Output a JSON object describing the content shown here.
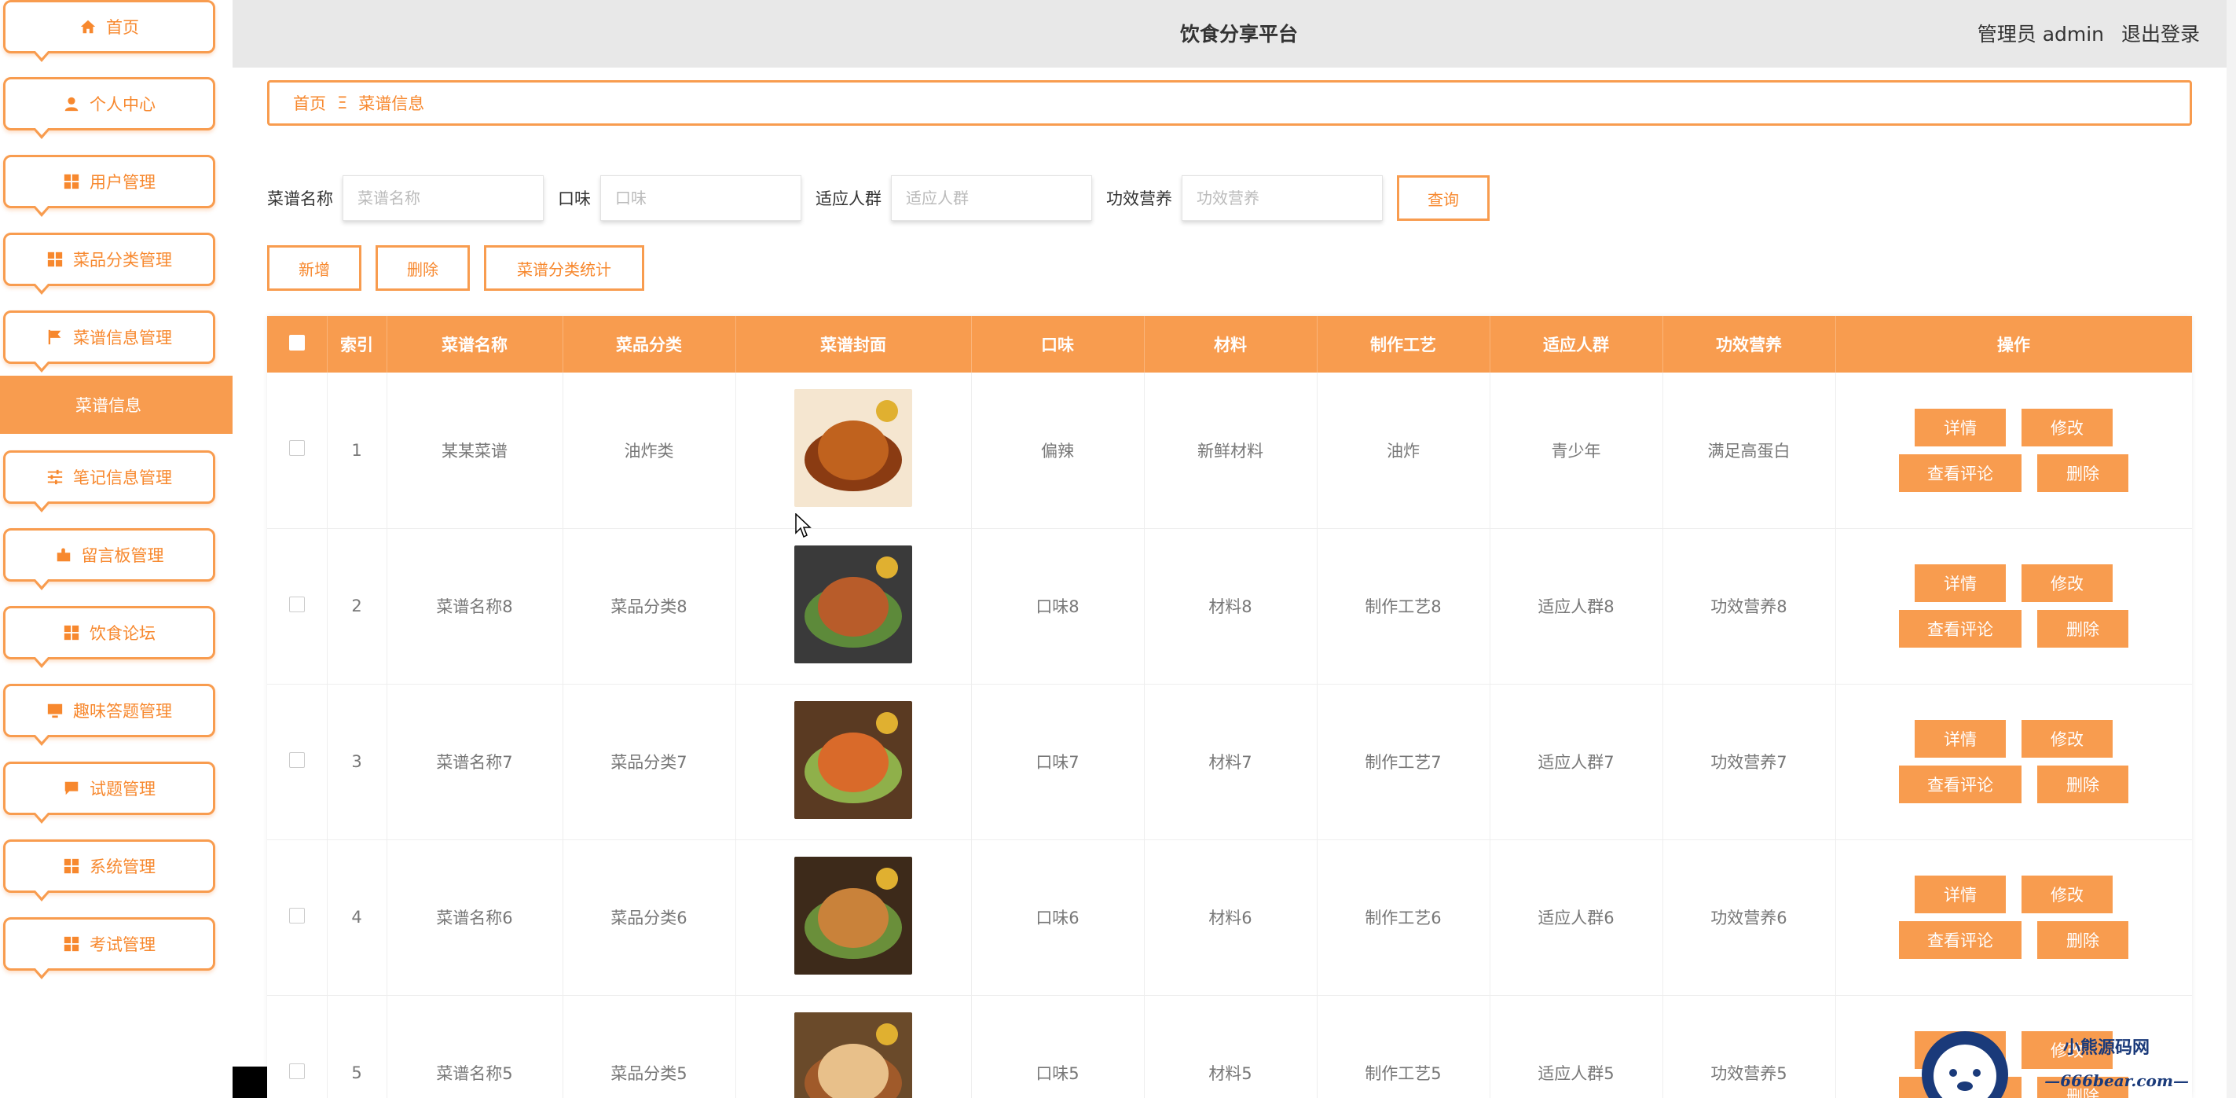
{
  "header": {
    "title": "饮食分享平台",
    "user": "管理员 admin",
    "logout": "退出登录"
  },
  "sidebar": {
    "items": [
      {
        "label": "首页",
        "icon": "home-icon"
      },
      {
        "label": "个人中心",
        "icon": "user-icon"
      },
      {
        "label": "用户管理",
        "icon": "grid-icon"
      },
      {
        "label": "菜品分类管理",
        "icon": "grid-icon"
      },
      {
        "label": "菜谱信息管理",
        "icon": "flag-icon"
      },
      {
        "label": "笔记信息管理",
        "icon": "sliders-icon"
      },
      {
        "label": "留言板管理",
        "icon": "puzzle-icon"
      },
      {
        "label": "饮食论坛",
        "icon": "grid-icon"
      },
      {
        "label": "趣味答题管理",
        "icon": "monitor-icon"
      },
      {
        "label": "试题管理",
        "icon": "chat-icon"
      },
      {
        "label": "系统管理",
        "icon": "grid-icon"
      },
      {
        "label": "考试管理",
        "icon": "grid-icon"
      }
    ],
    "active_sub": "菜谱信息"
  },
  "breadcrumb": {
    "home": "首页",
    "separator": "Ξ",
    "current": "菜谱信息"
  },
  "search": {
    "name_label": "菜谱名称",
    "name_placeholder": "菜谱名称",
    "taste_label": "口味",
    "taste_placeholder": "口味",
    "crowd_label": "适应人群",
    "crowd_placeholder": "适应人群",
    "nutrition_label": "功效营养",
    "nutrition_placeholder": "功效营养",
    "query_label": "查询"
  },
  "actions": {
    "add": "新增",
    "delete": "删除",
    "stats": "菜谱分类统计"
  },
  "table": {
    "columns": [
      "索引",
      "菜谱名称",
      "菜品分类",
      "菜谱封面",
      "口味",
      "材料",
      "制作工艺",
      "适应人群",
      "功效营养",
      "操作"
    ],
    "ops": {
      "detail": "详情",
      "edit": "修改",
      "comments": "查看评论",
      "remove": "删除"
    },
    "rows": [
      {
        "index": "1",
        "name": "某某菜谱",
        "category": "油炸类",
        "taste": "偏辣",
        "material": "新鲜材料",
        "craft": "油炸",
        "crowd": "青少年",
        "nutrition": "满足高蛋白"
      },
      {
        "index": "2",
        "name": "菜谱名称8",
        "category": "菜品分类8",
        "taste": "口味8",
        "material": "材料8",
        "craft": "制作工艺8",
        "crowd": "适应人群8",
        "nutrition": "功效营养8"
      },
      {
        "index": "3",
        "name": "菜谱名称7",
        "category": "菜品分类7",
        "taste": "口味7",
        "material": "材料7",
        "craft": "制作工艺7",
        "crowd": "适应人群7",
        "nutrition": "功效营养7"
      },
      {
        "index": "4",
        "name": "菜谱名称6",
        "category": "菜品分类6",
        "taste": "口味6",
        "material": "材料6",
        "craft": "制作工艺6",
        "crowd": "适应人群6",
        "nutrition": "功效营养6"
      },
      {
        "index": "5",
        "name": "菜谱名称5",
        "category": "菜品分类5",
        "taste": "口味5",
        "material": "材料5",
        "craft": "制作工艺5",
        "crowd": "适应人群5",
        "nutrition": "功效营养5"
      }
    ]
  },
  "watermark": {
    "line1": "小熊源码网",
    "line2": "—666bear.com—"
  },
  "colors": {
    "accent": "#f89c4f",
    "accent_text": "#f7882e",
    "header_bg": "#e8e8e8"
  }
}
